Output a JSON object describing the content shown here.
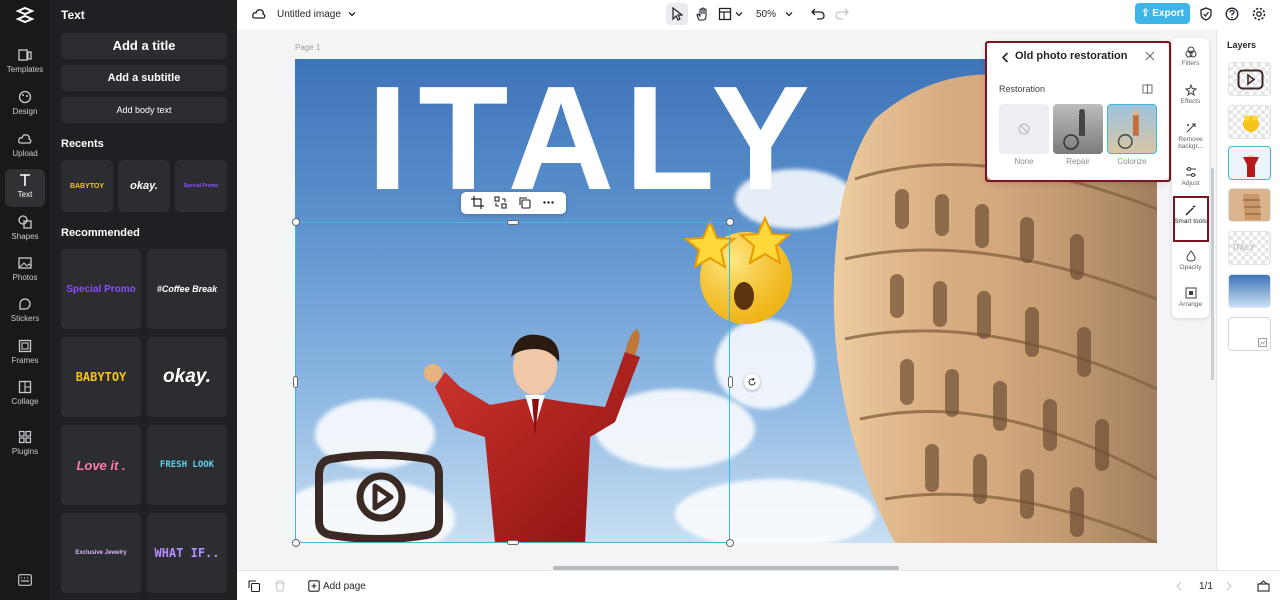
{
  "app": {
    "logo_icon": "capcut-logo-icon"
  },
  "rail": {
    "items": [
      {
        "label": "Templates",
        "icon": "templates-icon"
      },
      {
        "label": "Design",
        "icon": "design-icon"
      },
      {
        "label": "Upload",
        "icon": "upload-cloud-icon"
      },
      {
        "label": "Text",
        "icon": "text-icon",
        "active": true
      },
      {
        "label": "Shapes",
        "icon": "shapes-icon"
      },
      {
        "label": "Photos",
        "icon": "photos-icon"
      },
      {
        "label": "Stickers",
        "icon": "stickers-icon"
      },
      {
        "label": "Frames",
        "icon": "frames-icon"
      },
      {
        "label": "Collage",
        "icon": "collage-icon"
      },
      {
        "label": "Plugins",
        "icon": "plugins-icon"
      }
    ]
  },
  "panel": {
    "title": "Text",
    "add_title": "Add a title",
    "add_subtitle": "Add a subtitle",
    "add_body": "Add body text",
    "recents_title": "Recents",
    "recents": [
      "BABYTOY",
      "okay.",
      "Special Promo"
    ],
    "recommended_title": "Recommended",
    "recommended": [
      "Special Promo",
      "#Coffee Break",
      "BABYTOY",
      "okay.",
      "Love it .",
      "FRESH LOOK",
      "Exclusive Jewelry",
      "WHAT IF.."
    ]
  },
  "topbar": {
    "doc_title": "Untitled image",
    "zoom": "50%",
    "export_label": "Export"
  },
  "canvas": {
    "page_label": "Page 1",
    "headline": "ITALY"
  },
  "popup": {
    "title": "Old photo restoration",
    "section": "Restoration",
    "options": [
      "None",
      "Repair",
      "Colorize"
    ],
    "selected_option": "Colorize"
  },
  "tools": [
    {
      "label": "Filters",
      "icon": "filters-icon"
    },
    {
      "label": "Effects",
      "icon": "effects-icon"
    },
    {
      "label": "Remove backgr...",
      "icon": "remove-background-icon"
    },
    {
      "label": "Adjust",
      "icon": "adjust-icon"
    },
    {
      "label": "Smart tools",
      "icon": "magic-wand-icon"
    },
    {
      "label": "Opacity",
      "icon": "opacity-icon"
    },
    {
      "label": "Arrange",
      "icon": "arrange-icon"
    }
  ],
  "layers": {
    "title": "Layers"
  },
  "bottombar": {
    "add_page": "Add page",
    "page_count": "1/1"
  },
  "colors": {
    "accent": "#3fb8d8",
    "export": "#3db5e6",
    "highlight_outline": "#7a1420"
  }
}
